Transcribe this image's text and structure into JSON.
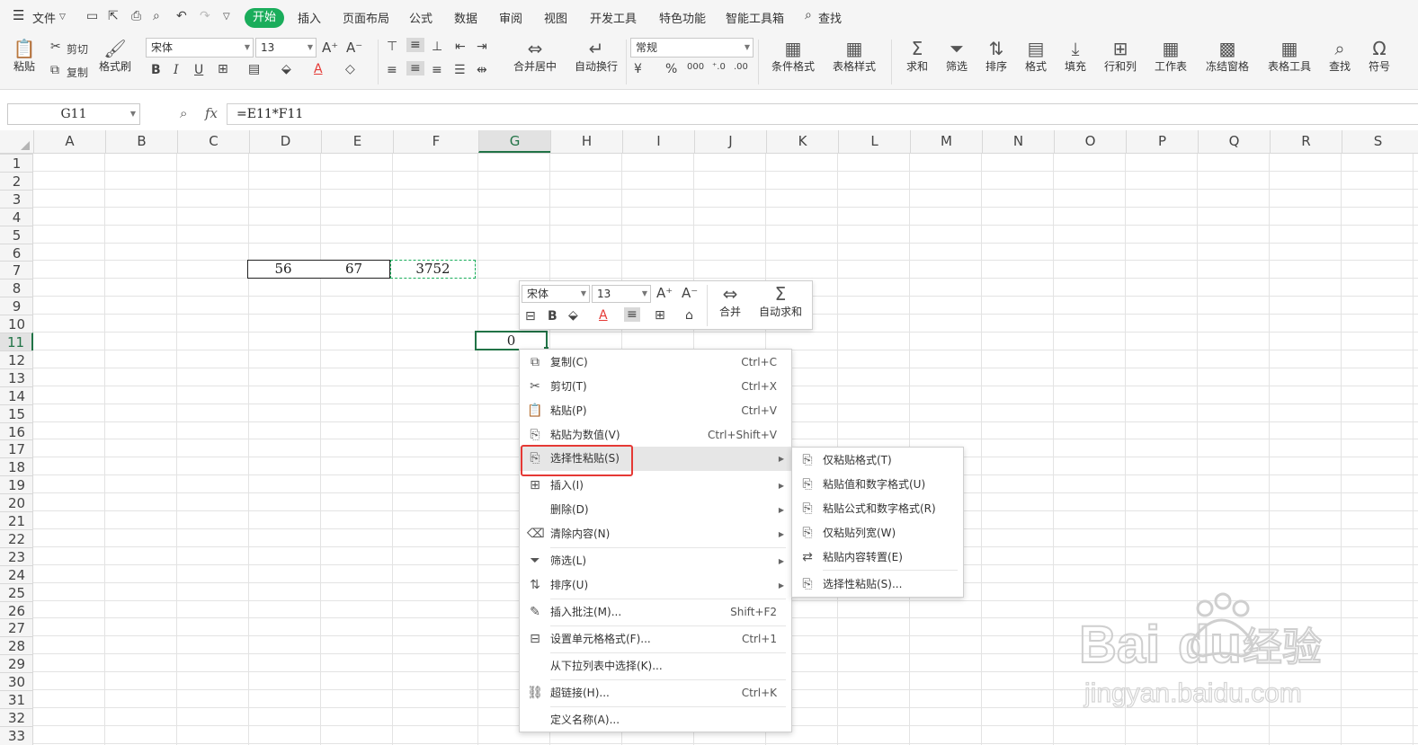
{
  "menubar": {
    "file": "文件",
    "tabs": [
      "开始",
      "插入",
      "页面布局",
      "公式",
      "数据",
      "审阅",
      "视图",
      "开发工具",
      "特色功能",
      "智能工具箱"
    ],
    "search": "查找"
  },
  "ribbon": {
    "paste": "粘贴",
    "cut": "剪切",
    "copy": "复制",
    "format_painter": "格式刷",
    "font": "宋体",
    "font_size": "13",
    "merge": "合并居中",
    "wrap": "自动换行",
    "number_format": "常规",
    "cond_format": "条件格式",
    "table_style": "表格样式",
    "sum": "求和",
    "filter": "筛选",
    "sort": "排序",
    "format": "格式",
    "fill": "填充",
    "rowcol": "行和列",
    "sheet": "工作表",
    "freeze": "冻结窗格",
    "table_tools": "表格工具",
    "find": "查找",
    "symbol": "符号",
    "percent": "%",
    "thousands": "000"
  },
  "formula_bar": {
    "name_box": "G11",
    "fx": "fx",
    "formula": "=E11*F11"
  },
  "columns": [
    "A",
    "B",
    "C",
    "D",
    "E",
    "F",
    "G",
    "H",
    "I",
    "J",
    "K",
    "L",
    "M",
    "N",
    "O",
    "P",
    "Q",
    "R",
    "S"
  ],
  "rows": [
    "1",
    "2",
    "3",
    "4",
    "5",
    "6",
    "7",
    "8",
    "9",
    "10",
    "11",
    "12",
    "13",
    "14",
    "15",
    "16",
    "17",
    "18",
    "19",
    "20",
    "21",
    "22",
    "23",
    "24",
    "25",
    "26",
    "27",
    "28",
    "29",
    "30",
    "31",
    "32",
    "33"
  ],
  "cells": {
    "D7": "56",
    "E7": "67",
    "F7": "3752",
    "G11": "0"
  },
  "mini_toolbar": {
    "font": "宋体",
    "size": "13",
    "merge": "合并",
    "autosum": "自动求和"
  },
  "context_menu": [
    {
      "icon": "copy-icon",
      "label": "复制(C)",
      "shortcut": "Ctrl+C"
    },
    {
      "icon": "cut-icon",
      "label": "剪切(T)",
      "shortcut": "Ctrl+X"
    },
    {
      "icon": "paste-icon",
      "label": "粘贴(P)",
      "shortcut": "Ctrl+V"
    },
    {
      "icon": "paste-values-icon",
      "label": "粘贴为数值(V)",
      "shortcut": "Ctrl+Shift+V"
    },
    {
      "icon": "paste-special-icon",
      "label": "选择性粘贴(S)",
      "shortcut": ""
    },
    {
      "icon": "insert-icon",
      "label": "插入(I)",
      "shortcut": ""
    },
    {
      "icon": "",
      "label": "删除(D)",
      "shortcut": ""
    },
    {
      "icon": "eraser-icon",
      "label": "清除内容(N)",
      "shortcut": ""
    },
    {
      "icon": "filter-icon",
      "label": "筛选(L)",
      "shortcut": ""
    },
    {
      "icon": "sort-icon",
      "label": "排序(U)",
      "shortcut": ""
    },
    {
      "icon": "comment-icon",
      "label": "插入批注(M)...",
      "shortcut": "Shift+F2"
    },
    {
      "icon": "format-cells-icon",
      "label": "设置单元格格式(F)...",
      "shortcut": "Ctrl+1"
    },
    {
      "icon": "",
      "label": "从下拉列表中选择(K)...",
      "shortcut": ""
    },
    {
      "icon": "link-icon",
      "label": "超链接(H)...",
      "shortcut": "Ctrl+K"
    },
    {
      "icon": "",
      "label": "定义名称(A)...",
      "shortcut": ""
    }
  ],
  "submenu": [
    {
      "label": "仅粘贴格式(T)"
    },
    {
      "label": "粘贴值和数字格式(U)"
    },
    {
      "label": "粘贴公式和数字格式(R)"
    },
    {
      "label": "仅粘贴列宽(W)"
    },
    {
      "label": "粘贴内容转置(E)"
    },
    {
      "label": "选择性粘贴(S)..."
    }
  ],
  "watermark": {
    "brand": "Bai",
    "brand2": "du",
    "cn": "经验",
    "url": "jingyan.baidu.com"
  },
  "colors": {
    "accent": "#1aad5b",
    "highlight": "#e53935",
    "selection": "#217346"
  }
}
